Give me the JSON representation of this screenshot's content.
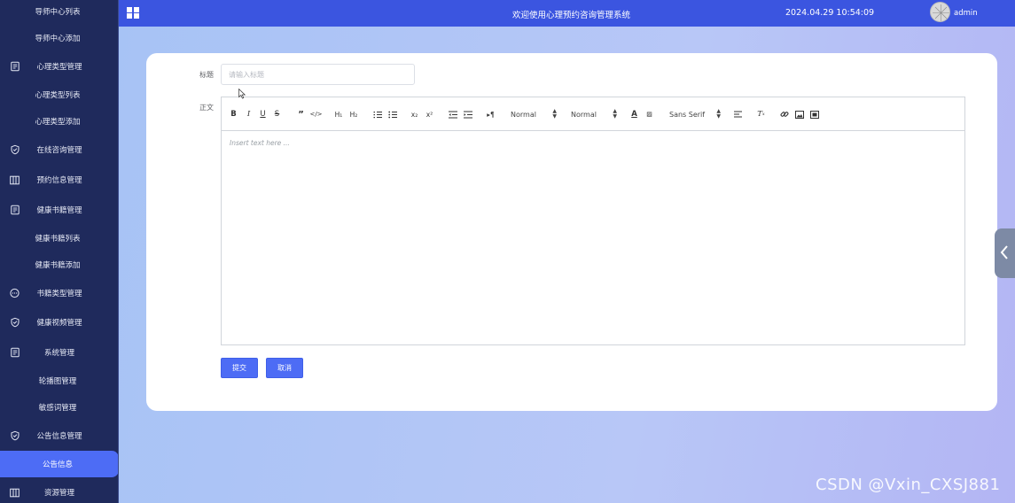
{
  "sidebar": {
    "items": [
      {
        "label": "导师中心列表",
        "icon": "",
        "sub": true
      },
      {
        "label": "导师中心添加",
        "icon": "",
        "sub": true
      },
      {
        "label": "心理类型管理",
        "icon": "document-icon",
        "sub": false
      },
      {
        "label": "心理类型列表",
        "icon": "",
        "sub": true
      },
      {
        "label": "心理类型添加",
        "icon": "",
        "sub": true
      },
      {
        "label": "在线咨询管理",
        "icon": "shield-icon",
        "sub": false
      },
      {
        "label": "预约信息管理",
        "icon": "columns-icon",
        "sub": false
      },
      {
        "label": "健康书籍管理",
        "icon": "document-icon",
        "sub": false
      },
      {
        "label": "健康书籍列表",
        "icon": "",
        "sub": true
      },
      {
        "label": "健康书籍添加",
        "icon": "",
        "sub": true
      },
      {
        "label": "书籍类型管理",
        "icon": "chat-icon",
        "sub": false
      },
      {
        "label": "健康视频管理",
        "icon": "shield-icon",
        "sub": false
      },
      {
        "label": "系统管理",
        "icon": "document-icon",
        "sub": false
      },
      {
        "label": "轮播图管理",
        "icon": "",
        "sub": true
      },
      {
        "label": "敏感词管理",
        "icon": "",
        "sub": true
      },
      {
        "label": "公告信息管理",
        "icon": "shield-icon",
        "sub": false
      },
      {
        "label": "公告信息",
        "icon": "",
        "sub": true,
        "active": true
      },
      {
        "label": "资源管理",
        "icon": "columns-icon",
        "sub": false
      }
    ]
  },
  "header": {
    "menu_icon": "grid-icon",
    "title": "欢迎使用心理预约咨询管理系统",
    "datetime": "2024.04.29 10:54:09",
    "username": "admin"
  },
  "form": {
    "title_label": "标题",
    "title_placeholder": "请输入标题",
    "title_value": "",
    "content_label": "正文",
    "editor_placeholder": "Insert text here ...",
    "header_select": "Normal",
    "size_select": "Normal",
    "font_select": "Sans Serif",
    "submit_label": "提交",
    "cancel_label": "取消"
  },
  "watermark": "CSDN @Vxin_CXSJ881",
  "colors": {
    "sidebar_bg": "#1f2a5c",
    "topbar_bg": "#3b55e0",
    "accent": "#4d6cf5"
  }
}
